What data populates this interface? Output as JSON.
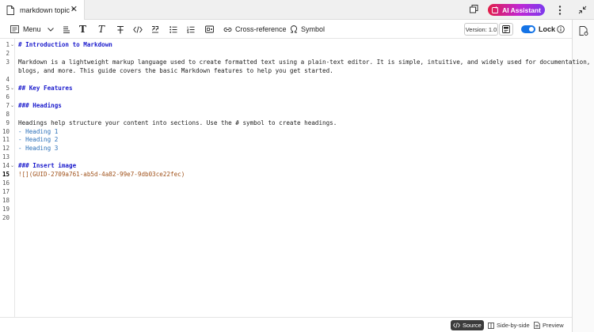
{
  "tab": {
    "title": "markdown topic *"
  },
  "header": {
    "ai_assistant_label": "AI Assistant"
  },
  "toolbar": {
    "menu_label": "Menu",
    "cross_reference_label": "Cross-reference",
    "symbol_label": "Symbol",
    "version_label": "Version: 1.0",
    "lock_label": "Lock",
    "lock_on": true
  },
  "editor": {
    "active_line": 15,
    "lines": [
      {
        "n": "1",
        "text": "# Introduction to Markdown",
        "kind": "h",
        "fold": true
      },
      {
        "n": "2",
        "text": "",
        "kind": "p"
      },
      {
        "n": "3",
        "text": "Markdown is a lightweight markup language used to create formatted text using a plain-text editor. It is simple, intuitive, and widely used for documentation,",
        "kind": "p"
      },
      {
        "n": "",
        "text": "blogs, and more. This guide covers the basic Markdown features to help you get started.",
        "kind": "p"
      },
      {
        "n": "4",
        "text": "",
        "kind": "p"
      },
      {
        "n": "5",
        "text": "## Key Features",
        "kind": "h",
        "fold": true
      },
      {
        "n": "6",
        "text": "",
        "kind": "p"
      },
      {
        "n": "7",
        "text": "### Headings",
        "kind": "h",
        "fold": true
      },
      {
        "n": "8",
        "text": "",
        "kind": "p"
      },
      {
        "n": "9",
        "text": "Headings help structure your content into sections. Use the # symbol to create headings.",
        "kind": "p"
      },
      {
        "n": "10",
        "text": "- Heading 1",
        "kind": "li"
      },
      {
        "n": "11",
        "text": "- Heading 2",
        "kind": "li"
      },
      {
        "n": "12",
        "text": "- Heading 3",
        "kind": "li"
      },
      {
        "n": "13",
        "text": "",
        "kind": "p"
      },
      {
        "n": "14",
        "text": "### Insert image",
        "kind": "h",
        "fold": true
      },
      {
        "n": "15",
        "text": "![](GUID-2709a761-ab5d-4a82-99e7-9db03ce22fec)",
        "kind": "img"
      },
      {
        "n": "16",
        "text": "",
        "kind": "p"
      },
      {
        "n": "17",
        "text": "",
        "kind": "p"
      },
      {
        "n": "18",
        "text": "",
        "kind": "p"
      },
      {
        "n": "19",
        "text": "",
        "kind": "p"
      },
      {
        "n": "20",
        "text": "",
        "kind": "p"
      }
    ]
  },
  "footer": {
    "modes": [
      {
        "label": "Source",
        "active": true,
        "icon": "code-icon"
      },
      {
        "label": "Side-by-side",
        "active": false,
        "icon": "split-view-icon"
      },
      {
        "label": "Preview",
        "active": false,
        "icon": "preview-icon"
      }
    ]
  },
  "colors": {
    "accent": "#1473e6",
    "heading": "#1a1acc",
    "list": "#2a6fb8",
    "image_ref": "#a0521b"
  }
}
